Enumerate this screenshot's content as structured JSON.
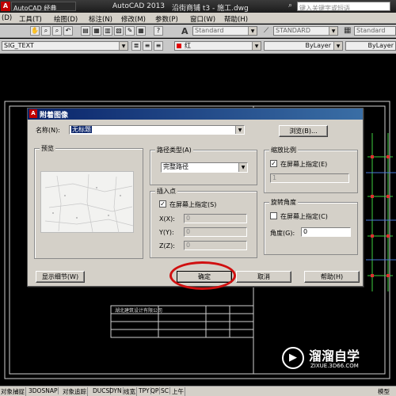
{
  "titlebar": {
    "workspace": "AutoCAD 经典",
    "app_name": "AutoCAD 2013",
    "file_name": "沿街商铺 t3 - 施工.dwg",
    "search_placeholder": "键入关键字或短语"
  },
  "menu": [
    "(D)",
    "工具(T)",
    "绘图(D)",
    "标注(N)",
    "修改(M)",
    "参数(P)",
    "窗口(W)",
    "帮助(H)"
  ],
  "toolbar_row2": {
    "textstyle": "Standard",
    "dimstyle": "STANDARD",
    "tablestyle": "Standard"
  },
  "toolbar_row3": {
    "layer": "SIG_TEXT",
    "color": "红",
    "linetype": "ByLayer",
    "lineweight": "ByLayer"
  },
  "dialog": {
    "title": "附着图像",
    "name_label": "名称(N):",
    "name_value": "无标题",
    "browse_label": "浏览(B)...",
    "preview_label": "预览",
    "path_group": "路径类型(A)",
    "path_value": "完整路径",
    "insert_group": "插入点",
    "insert_check_label": "在屏幕上指定(S)",
    "insert_checked": true,
    "x_label": "X(X):",
    "y_label": "Y(Y):",
    "z_label": "Z(Z):",
    "x_value": "0",
    "y_value": "0",
    "z_value": "0",
    "scale_group": "缩放比例",
    "scale_check_label": "在屏幕上指定(E)",
    "scale_checked": true,
    "scale_value": "1",
    "rotation_group": "旋转角度",
    "rotation_check_label": "在屏幕上指定(C)",
    "rotation_checked": false,
    "angle_label": "角度(G):",
    "angle_value": "0",
    "details_button": "显示细节(W)",
    "ok_button": "确定",
    "cancel_button": "取消",
    "help_button": "帮助(H)"
  },
  "drawing": {
    "title_block_text": "湖北建筑设计有限公司"
  },
  "status": [
    "对象捕捉",
    "3DOSNAP",
    "对象追踪",
    "DUCS",
    "DYN",
    "线宽",
    "TPY",
    "QP",
    "SC",
    "上午"
  ],
  "status_right": "模型",
  "watermark": {
    "brand": "溜溜自学",
    "url": "ZIXUE.3D66.COM"
  },
  "colors": {
    "dialog_bg": "#d4d0c8",
    "title_blue": "#0a246a",
    "highlight_red": "#d01010",
    "drawing_bg": "#000000"
  }
}
